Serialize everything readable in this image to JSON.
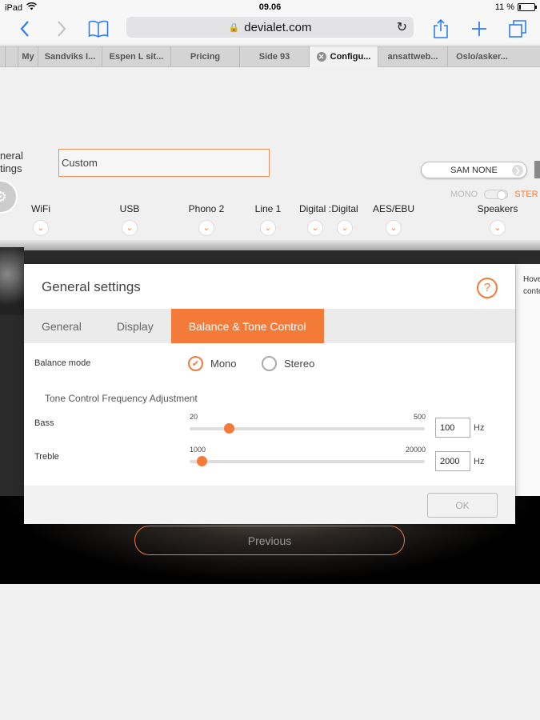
{
  "status_bar": {
    "device": "iPad",
    "time": "09.06",
    "battery_percent": "11 %",
    "battery_level": 0.11
  },
  "toolbar": {
    "url": "devialet.com",
    "back_icon": "back-chevron-icon",
    "forward_icon": "forward-chevron-icon",
    "bookmarks_icon": "book-icon",
    "share_icon": "share-icon",
    "add_icon": "plus-icon",
    "tabs_icon": "tabs-icon"
  },
  "browser_tabs": [
    {
      "label": "My",
      "active": false
    },
    {
      "label": "Sandviks I...",
      "active": false
    },
    {
      "label": "Espen L sit...",
      "active": false
    },
    {
      "label": "Pricing",
      "active": false
    },
    {
      "label": "Side 93",
      "active": false
    },
    {
      "label": "Configu...",
      "active": true
    },
    {
      "label": "ansattweb...",
      "active": false
    },
    {
      "label": "Oslo/asker...",
      "active": false
    }
  ],
  "page": {
    "side_label_1": "neral",
    "side_label_2": "tings",
    "config_name": "Custom",
    "sam_button": "SAM NONE",
    "mono_label": "MONO",
    "stereo_label": "STER",
    "inputs": [
      "WiFi",
      "USB",
      "Phono 2",
      "Line 1",
      "Digital :",
      "Digital",
      "AES/EBU",
      "Speakers"
    ],
    "side_help_1": "Hove",
    "side_help_2": "conte",
    "previous_button": "Previous"
  },
  "modal": {
    "title": "General settings",
    "help_icon": "?",
    "tabs": [
      {
        "label": "General",
        "active": false
      },
      {
        "label": "Display",
        "active": false
      },
      {
        "label": "Balance & Tone Control",
        "active": true
      }
    ],
    "balance_mode_label": "Balance mode",
    "balance_options": [
      {
        "label": "Mono",
        "checked": true
      },
      {
        "label": "Stereo",
        "checked": false
      }
    ],
    "tone_heading": "Tone Control Frequency Adjustment",
    "bass": {
      "label": "Bass",
      "min": "20",
      "max": "500",
      "value": "100",
      "unit": "Hz"
    },
    "treble": {
      "label": "Treble",
      "min": "1000",
      "max": "20000",
      "value": "2000",
      "unit": "Hz"
    },
    "ok_button": "OK"
  },
  "colors": {
    "accent": "#f47a3a",
    "ios_blue": "#2f7cf6"
  }
}
